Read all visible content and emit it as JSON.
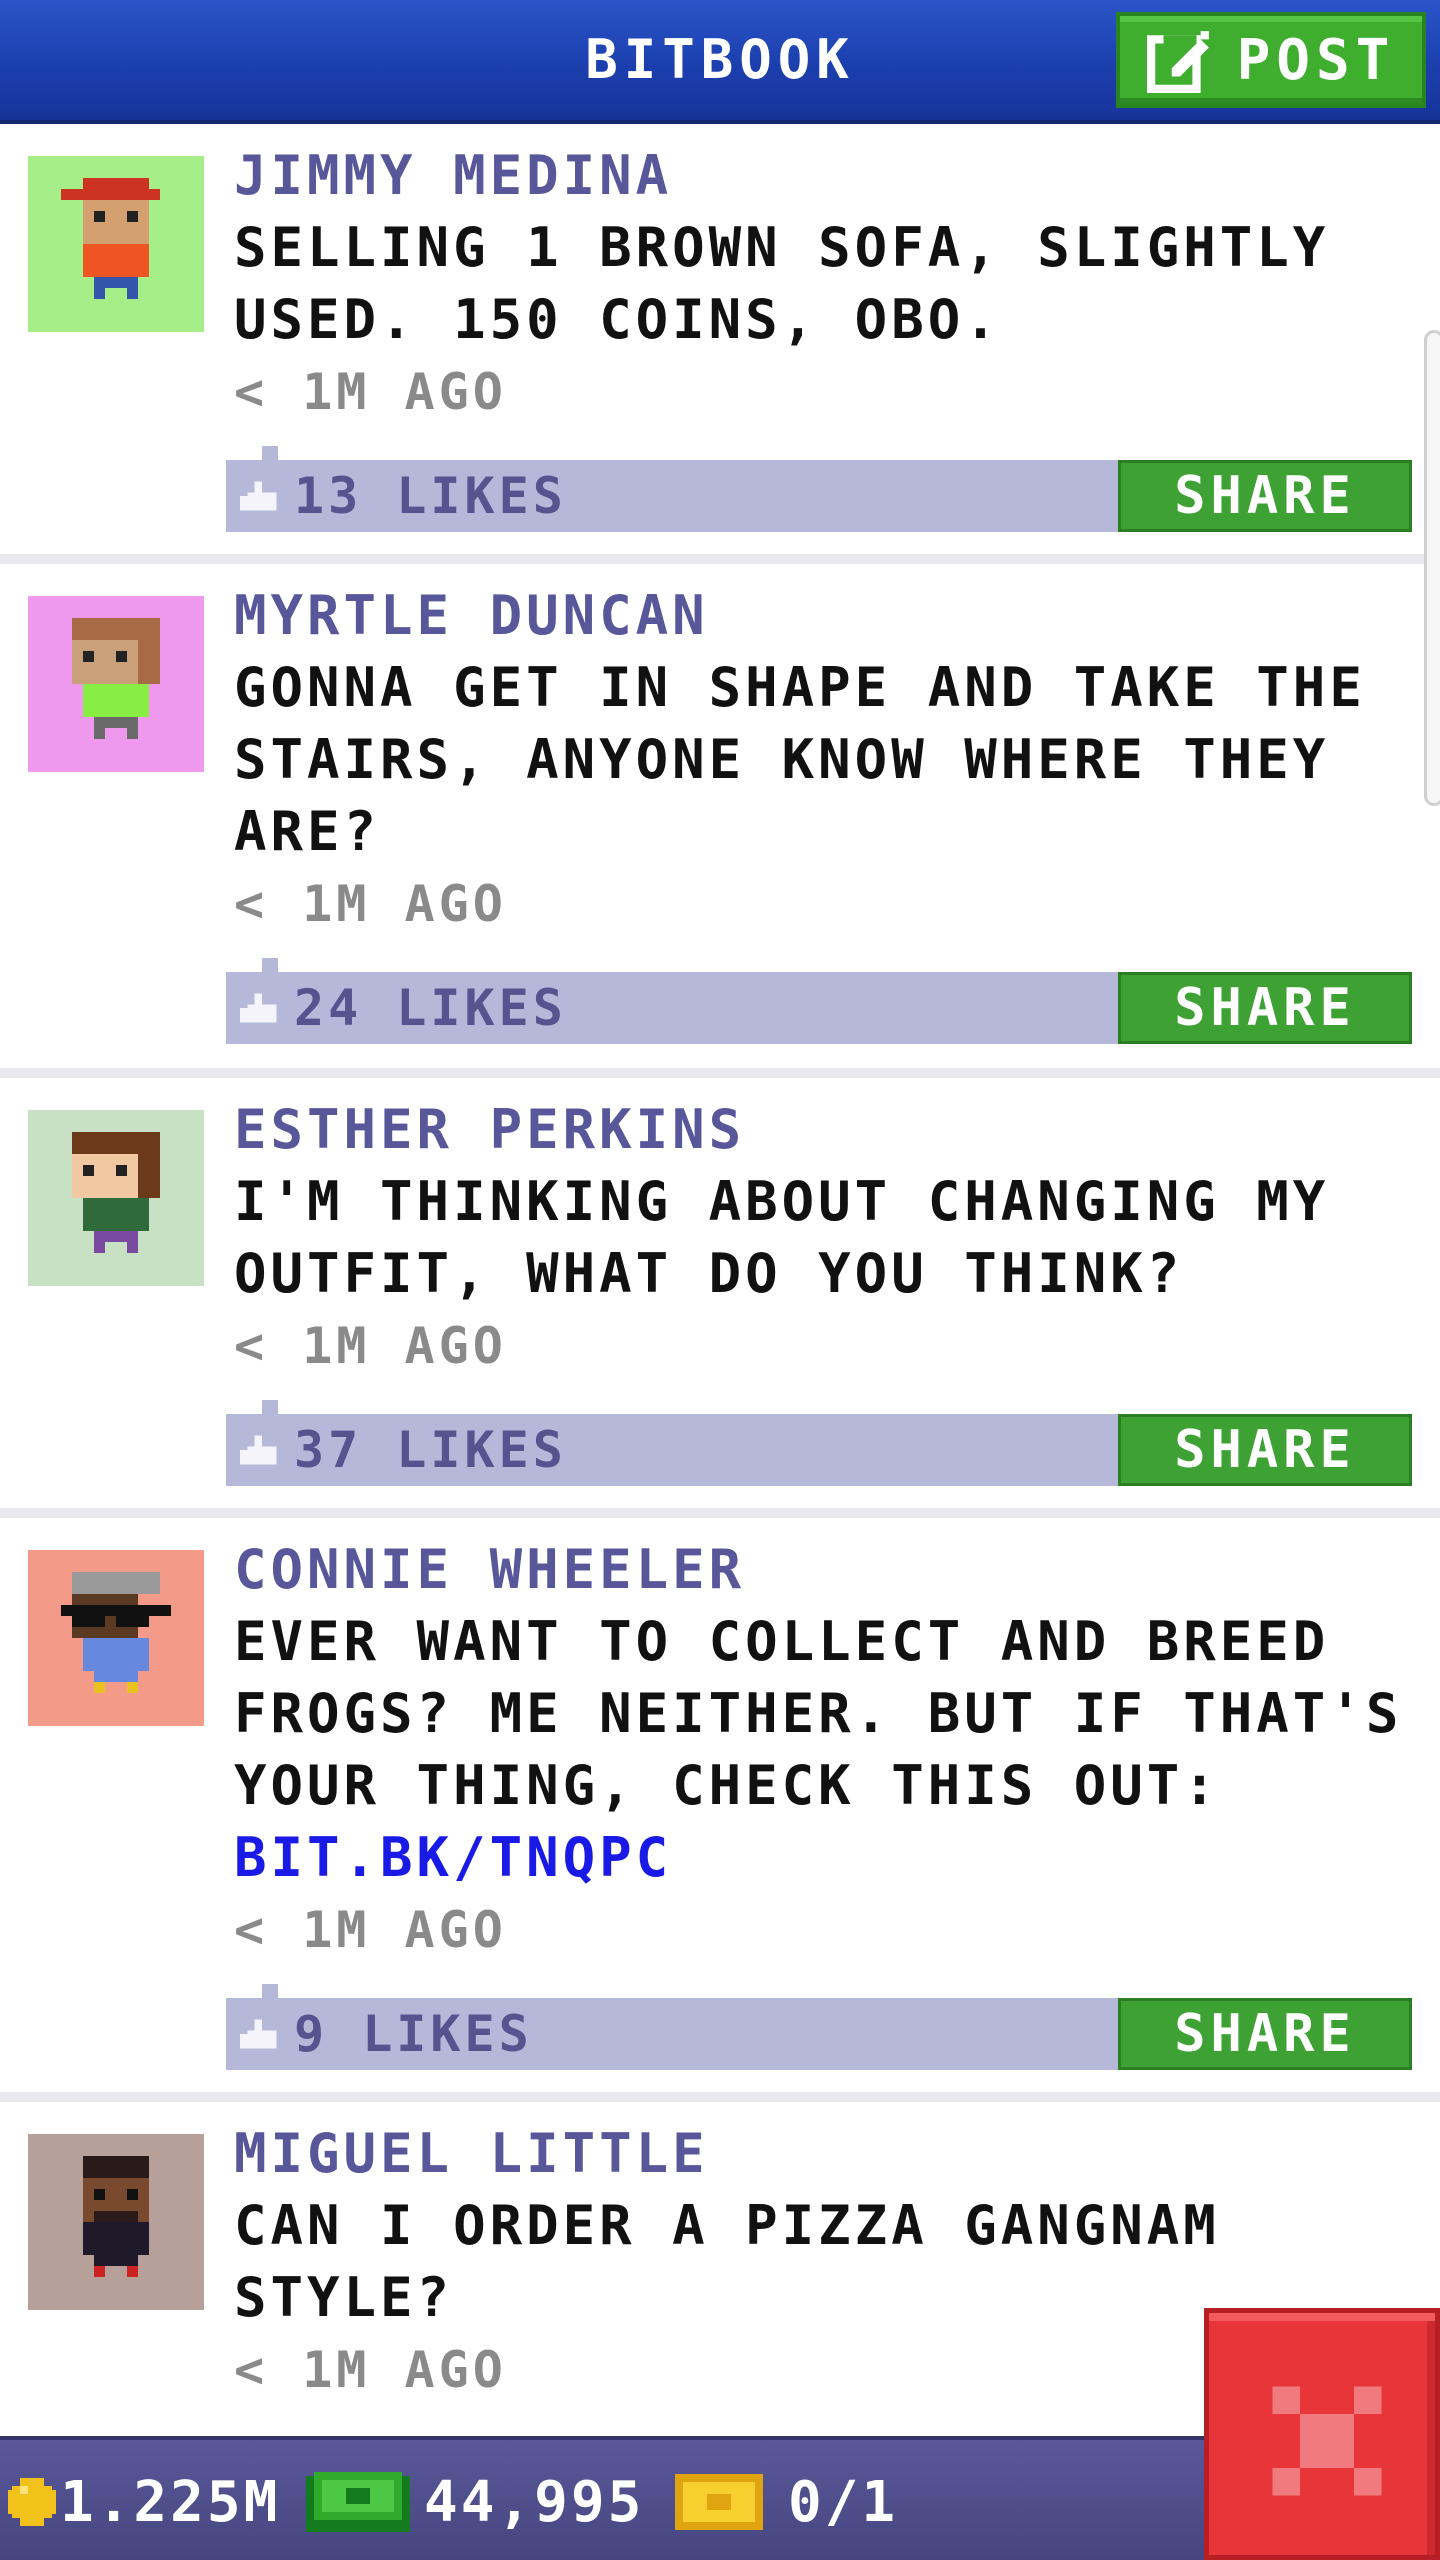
{
  "header": {
    "title": "BITBOOK",
    "post_label": "POST"
  },
  "posts": [
    {
      "author": "JIMMY MEDINA",
      "message": "SELLING 1 BROWN SOFA, SLIGHTLY\nUSED. 150 COINS, OBO.",
      "time": "< 1M AGO",
      "likes": "13 LIKES",
      "share": "SHARE"
    },
    {
      "author": "MYRTLE DUNCAN",
      "message": "GONNA GET IN SHAPE AND TAKE THE\nSTAIRS, ANYONE KNOW WHERE THEY\nARE?",
      "time": "< 1M AGO",
      "likes": "24 LIKES",
      "share": "SHARE"
    },
    {
      "author": "ESTHER PERKINS",
      "message": "I'M THINKING ABOUT CHANGING MY\nOUTFIT, WHAT DO YOU THINK?",
      "time": "< 1M AGO",
      "likes": "37 LIKES",
      "share": "SHARE"
    },
    {
      "author": "CONNIE WHEELER",
      "message": "EVER WANT TO COLLECT AND BREED\nFROGS? ME NEITHER. BUT IF THAT'S\nYOUR THING, CHECK THIS OUT:",
      "link": "BIT.BK/TNQPC",
      "time": "< 1M AGO",
      "likes": "9 LIKES",
      "share": "SHARE"
    },
    {
      "author": "MIGUEL LITTLE",
      "message": "CAN I ORDER A PIZZA GANGNAM\nSTYLE?",
      "time": "< 1M AGO"
    }
  ],
  "status_bar": {
    "coins": "1.225M",
    "bux": "44,995",
    "tickets": "0/1"
  },
  "colors": {
    "header_blue": "#1c3fae",
    "post_green": "#3fae2f",
    "like_bar": "#b6b8da",
    "author": "#57579a",
    "link": "#1a1ae6",
    "close_red": "#e8353a"
  }
}
